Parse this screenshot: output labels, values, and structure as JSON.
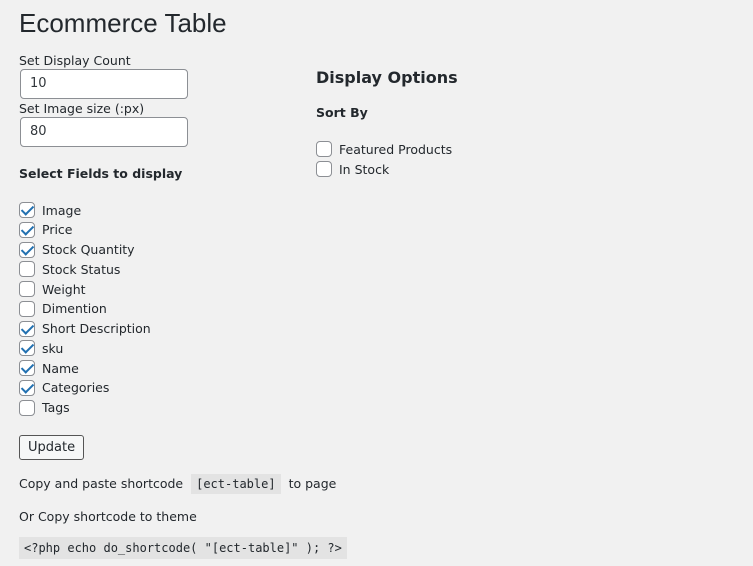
{
  "page": {
    "title": "Ecommerce Table"
  },
  "display_count": {
    "label": "Set Display Count",
    "value": "10"
  },
  "image_size": {
    "label": "Set Image size (:px)",
    "value": "80"
  },
  "fields": {
    "heading": "Select Fields to display",
    "items": [
      {
        "label": "Image",
        "checked": true
      },
      {
        "label": "Price",
        "checked": true
      },
      {
        "label": "Stock Quantity",
        "checked": true
      },
      {
        "label": "Stock Status",
        "checked": false
      },
      {
        "label": "Weight",
        "checked": false
      },
      {
        "label": "Dimention",
        "checked": false
      },
      {
        "label": "Short Description",
        "checked": true
      },
      {
        "label": "sku",
        "checked": true
      },
      {
        "label": "Name",
        "checked": true
      },
      {
        "label": "Categories",
        "checked": true
      },
      {
        "label": "Tags",
        "checked": false
      }
    ]
  },
  "display_options": {
    "heading": "Display Options",
    "sort_by_label": "Sort By",
    "items": [
      {
        "label": "Featured Products",
        "checked": false
      },
      {
        "label": "In Stock",
        "checked": false
      }
    ]
  },
  "update_button": {
    "label": "Update"
  },
  "shortcode": {
    "prefix": "Copy and paste shortcode",
    "code": "[ect-table]",
    "suffix": "to page",
    "theme_text": "Or Copy shortcode to theme",
    "php_code": "<?php echo do_shortcode( \"[ect-table]\" ); ?>"
  },
  "colors": {
    "check_accent": "#2271b1",
    "background": "#f1f1f1",
    "code_bg": "#e3e3e3"
  }
}
